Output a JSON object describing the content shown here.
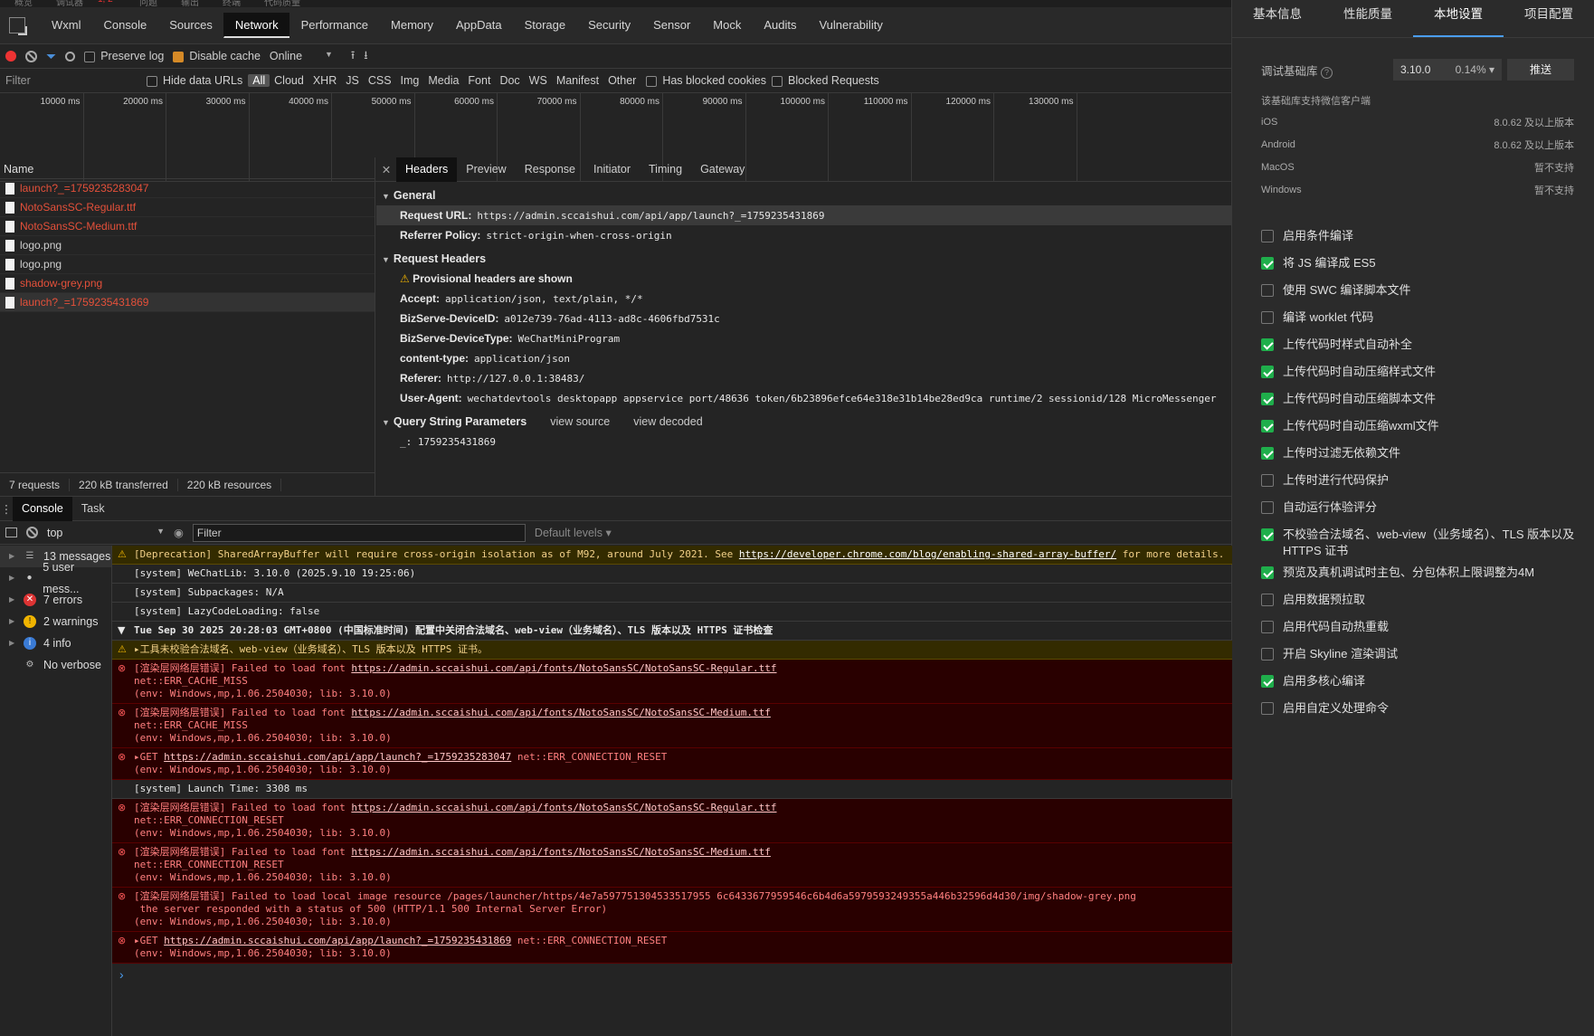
{
  "top_strip": [
    "概览",
    "调试器",
    "1, 2",
    "问题",
    "输出",
    "终端",
    "代码质量"
  ],
  "devtools_tabs": [
    "Wxml",
    "Console",
    "Sources",
    "Network",
    "Performance",
    "Memory",
    "AppData",
    "Storage",
    "Security",
    "Sensor",
    "Mock",
    "Audits",
    "Vulnerability"
  ],
  "active_tab": "Network",
  "toolbar": {
    "preserve_log": "Preserve log",
    "disable_cache": "Disable cache",
    "throttle": "Online"
  },
  "filterbar": {
    "placeholder": "Filter",
    "hide_data_urls": "Hide data URLs",
    "types": [
      "All",
      "Cloud",
      "XHR",
      "JS",
      "CSS",
      "Img",
      "Media",
      "Font",
      "Doc",
      "WS",
      "Manifest",
      "Other"
    ],
    "has_blocked_cookies": "Has blocked cookies",
    "blocked_requests": "Blocked Requests"
  },
  "timeline_ticks": [
    "10000 ms",
    "20000 ms",
    "30000 ms",
    "40000 ms",
    "50000 ms",
    "60000 ms",
    "70000 ms",
    "80000 ms",
    "90000 ms",
    "100000 ms",
    "110000 ms",
    "120000 ms",
    "130000 ms"
  ],
  "requests": {
    "header": "Name",
    "rows": [
      {
        "name": "launch?_=1759235283047",
        "error": true
      },
      {
        "name": "NotoSansSC-Regular.ttf",
        "error": true
      },
      {
        "name": "NotoSansSC-Medium.ttf",
        "error": true
      },
      {
        "name": "logo.png",
        "error": false
      },
      {
        "name": "logo.png",
        "error": false
      },
      {
        "name": "shadow-grey.png",
        "error": true
      },
      {
        "name": "launch?_=1759235431869",
        "error": true
      }
    ],
    "footer": [
      "7 requests",
      "220 kB transferred",
      "220 kB resources"
    ]
  },
  "detail_tabs": [
    "Headers",
    "Preview",
    "Response",
    "Initiator",
    "Timing",
    "Gateway"
  ],
  "general": {
    "title": "General",
    "rows": [
      {
        "k": "Request URL:",
        "v": "https://admin.sccaishui.com/api/app/launch?_=1759235431869"
      },
      {
        "k": "Referrer Policy:",
        "v": "strict-origin-when-cross-origin"
      }
    ]
  },
  "request_headers": {
    "title": "Request Headers",
    "provisional": "Provisional headers are shown",
    "rows": [
      {
        "k": "Accept:",
        "v": "application/json, text/plain, */*"
      },
      {
        "k": "BizServe-DeviceID:",
        "v": "a012e739-76ad-4113-ad8c-4606fbd7531c"
      },
      {
        "k": "BizServe-DeviceType:",
        "v": "WeChatMiniProgram"
      },
      {
        "k": "content-type:",
        "v": "application/json"
      },
      {
        "k": "Referer:",
        "v": "http://127.0.0.1:38483/"
      },
      {
        "k": "User-Agent:",
        "v": "wechatdevtools desktopapp appservice port/48636 token/6b23896efce64e318e31b14be28ed9ca runtime/2 sessionid/128 MicroMessenger"
      }
    ]
  },
  "query": {
    "title": "Query String Parameters",
    "view_source": "view source",
    "view_decoded": "view decoded",
    "param": "_: 1759235431869"
  },
  "console": {
    "tabs": [
      "Console",
      "Task"
    ],
    "context": "top",
    "filter_placeholder": "Filter",
    "levels": "Default levels",
    "sidebar": [
      {
        "label": "13 messages",
        "icon": "list-icon"
      },
      {
        "label": "5 user mess...",
        "icon": "user-icon"
      },
      {
        "label": "7 errors",
        "icon": "error-icon"
      },
      {
        "label": "2 warnings",
        "icon": "warning-icon"
      },
      {
        "label": "4 info",
        "icon": "info-icon"
      },
      {
        "label": "No verbose",
        "icon": "gear-icon"
      }
    ],
    "lines": [
      {
        "kind": "warn",
        "text": "[Deprecation] SharedArrayBuffer will require cross-origin isolation as of M92, around July 2021. See ",
        "link": "https://developer.chrome.com/blog/enabling-shared-array-buffer/",
        "tail": " for more details."
      },
      {
        "kind": "sys",
        "text": "[system] WeChatLib: 3.10.0 (2025.9.10 19:25:06)"
      },
      {
        "kind": "sys",
        "text": "[system] Subpackages: N/A"
      },
      {
        "kind": "sys",
        "text": "[system] LazyCodeLoading: false"
      },
      {
        "kind": "grp",
        "text": "Tue Sep 30 2025 20:28:03 GMT+0800 (中国标准时间) 配置中关闭合法域名、web-view（业务域名）、TLS 版本以及 HTTPS 证书检查"
      },
      {
        "kind": "warn",
        "text": "▸工具未校验合法域名、web-view（业务域名）、TLS 版本以及 HTTPS 证书。"
      },
      {
        "kind": "err",
        "text": "[渲染层网络层错误] Failed to load font ",
        "link": "https://admin.sccaishui.com/api/fonts/NotoSansSC/NotoSansSC-Regular.ttf",
        "tail": "\nnet::ERR_CACHE_MISS\n(env: Windows,mp,1.06.2504030; lib: 3.10.0)"
      },
      {
        "kind": "err",
        "text": "[渲染层网络层错误] Failed to load font ",
        "link": "https://admin.sccaishui.com/api/fonts/NotoSansSC/NotoSansSC-Medium.ttf",
        "tail": "\nnet::ERR_CACHE_MISS\n(env: Windows,mp,1.06.2504030; lib: 3.10.0)"
      },
      {
        "kind": "err",
        "text": "▸GET ",
        "link": "https://admin.sccaishui.com/api/app/launch?_=1759235283047",
        "tail": " net::ERR_CONNECTION_RESET\n(env: Windows,mp,1.06.2504030; lib: 3.10.0)"
      },
      {
        "kind": "sys",
        "text": "[system] Launch Time: 3308 ms"
      },
      {
        "kind": "err",
        "text": "[渲染层网络层错误] Failed to load font ",
        "link": "https://admin.sccaishui.com/api/fonts/NotoSansSC/NotoSansSC-Regular.ttf",
        "tail": "\nnet::ERR_CONNECTION_RESET\n(env: Windows,mp,1.06.2504030; lib: 3.10.0)"
      },
      {
        "kind": "err",
        "text": "[渲染层网络层错误] Failed to load font ",
        "link": "https://admin.sccaishui.com/api/fonts/NotoSansSC/NotoSansSC-Medium.ttf",
        "tail": "\nnet::ERR_CONNECTION_RESET\n(env: Windows,mp,1.06.2504030; lib: 3.10.0)"
      },
      {
        "kind": "err",
        "text": "[渲染层网络层错误] Failed to load local image resource /pages/launcher/https/4e7a597751304533517955 6c6433677959546c6b4d6a5979593249355a446b32596d4d30/img/shadow-grey.png\n the server responded with a status of 500 (HTTP/1.1 500 Internal Server Error)\n(env: Windows,mp,1.06.2504030; lib: 3.10.0)"
      },
      {
        "kind": "err",
        "text": "▸GET ",
        "link": "https://admin.sccaishui.com/api/app/launch?_=1759235431869",
        "tail": " net::ERR_CONNECTION_RESET\n(env: Windows,mp,1.06.2504030; lib: 3.10.0)"
      }
    ]
  },
  "right_panel": {
    "tabs": [
      "基本信息",
      "性能质量",
      "本地设置",
      "项目配置"
    ],
    "active_tab": "本地设置",
    "lib_label": "调试基础库",
    "lib_version": "3.10.0",
    "lib_percent": "0.14%",
    "push_button": "推送",
    "support_title": "该基础库支持微信客户端",
    "support": [
      {
        "os": "iOS",
        "v": "8.0.62 及以上版本"
      },
      {
        "os": "Android",
        "v": "8.0.62 及以上版本"
      },
      {
        "os": "MacOS",
        "v": "暂不支持"
      },
      {
        "os": "Windows",
        "v": "暂不支持"
      }
    ],
    "options": [
      {
        "label": "启用条件编译",
        "on": false
      },
      {
        "label": "将 JS 编译成 ES5",
        "on": true
      },
      {
        "label": "使用 SWC 编译脚本文件",
        "on": false
      },
      {
        "label": "编译 worklet 代码",
        "on": false
      },
      {
        "label": "上传代码时样式自动补全",
        "on": true
      },
      {
        "label": "上传代码时自动压缩样式文件",
        "on": true
      },
      {
        "label": "上传代码时自动压缩脚本文件",
        "on": true
      },
      {
        "label": "上传代码时自动压缩wxml文件",
        "on": true
      },
      {
        "label": "上传时过滤无依赖文件",
        "on": true
      },
      {
        "label": "上传时进行代码保护",
        "on": false
      },
      {
        "label": "自动运行体验评分",
        "on": false
      },
      {
        "label": "不校验合法域名、web-view（业务域名）、TLS 版本以及 HTTPS 证书",
        "on": true
      },
      {
        "label": "预览及真机调试时主包、分包体积上限调整为4M",
        "on": true
      },
      {
        "label": "启用数据预拉取",
        "on": false
      },
      {
        "label": "启用代码自动热重载",
        "on": false
      },
      {
        "label": "开启 Skyline 渲染调试",
        "on": false
      },
      {
        "label": "启用多核心编译",
        "on": true
      },
      {
        "label": "启用自定义处理命令",
        "on": false
      }
    ]
  },
  "colors": {
    "error": "#e4503a",
    "accent": "#4a9df0",
    "check": "#1fae4b",
    "warning": "#f0b400"
  }
}
